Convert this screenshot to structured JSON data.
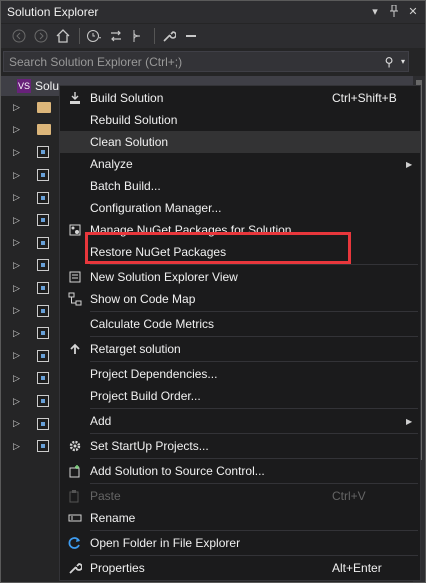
{
  "window": {
    "title": "Solution Explorer"
  },
  "search": {
    "placeholder": "Search Solution Explorer (Ctrl+;)"
  },
  "tree": {
    "root_label": "Solu"
  },
  "menu": {
    "items": [
      {
        "label": "Build Solution",
        "shortcut": "Ctrl+Shift+B",
        "icon": "build-icon"
      },
      {
        "label": "Rebuild Solution",
        "shortcut": "",
        "icon": ""
      },
      {
        "label": "Clean Solution",
        "shortcut": "",
        "icon": ""
      },
      {
        "label": "Analyze",
        "shortcut": "",
        "icon": "",
        "submenu": true
      },
      {
        "label": "Batch Build...",
        "shortcut": "",
        "icon": ""
      },
      {
        "label": "Configuration Manager...",
        "shortcut": "",
        "icon": ""
      },
      {
        "label": "Manage NuGet Packages for Solution...",
        "shortcut": "",
        "icon": "nuget-icon"
      },
      {
        "label": "Restore NuGet Packages",
        "shortcut": "",
        "icon": ""
      },
      {
        "label": "New Solution Explorer View",
        "shortcut": "",
        "icon": "new-view-icon"
      },
      {
        "label": "Show on Code Map",
        "shortcut": "",
        "icon": "code-map-icon"
      },
      {
        "label": "Calculate Code Metrics",
        "shortcut": "",
        "icon": ""
      },
      {
        "label": "Retarget solution",
        "shortcut": "",
        "icon": "arrow-up-icon"
      },
      {
        "label": "Project Dependencies...",
        "shortcut": "",
        "icon": ""
      },
      {
        "label": "Project Build Order...",
        "shortcut": "",
        "icon": ""
      },
      {
        "label": "Add",
        "shortcut": "",
        "icon": "",
        "submenu": true
      },
      {
        "label": "Set StartUp Projects...",
        "shortcut": "",
        "icon": "gear-icon"
      },
      {
        "label": "Add Solution to Source Control...",
        "shortcut": "",
        "icon": "source-control-icon"
      },
      {
        "label": "Paste",
        "shortcut": "Ctrl+V",
        "icon": "paste-icon",
        "disabled": true
      },
      {
        "label": "Rename",
        "shortcut": "",
        "icon": "rename-icon"
      },
      {
        "label": "Open Folder in File Explorer",
        "shortcut": "",
        "icon": "refresh-icon"
      },
      {
        "label": "Properties",
        "shortcut": "Alt+Enter",
        "icon": "wrench-icon"
      }
    ]
  },
  "colors": {
    "background": "#252526",
    "menu_background": "#1b1b1c",
    "highlight_box": "#e8373c",
    "hover_row": "#333334"
  }
}
